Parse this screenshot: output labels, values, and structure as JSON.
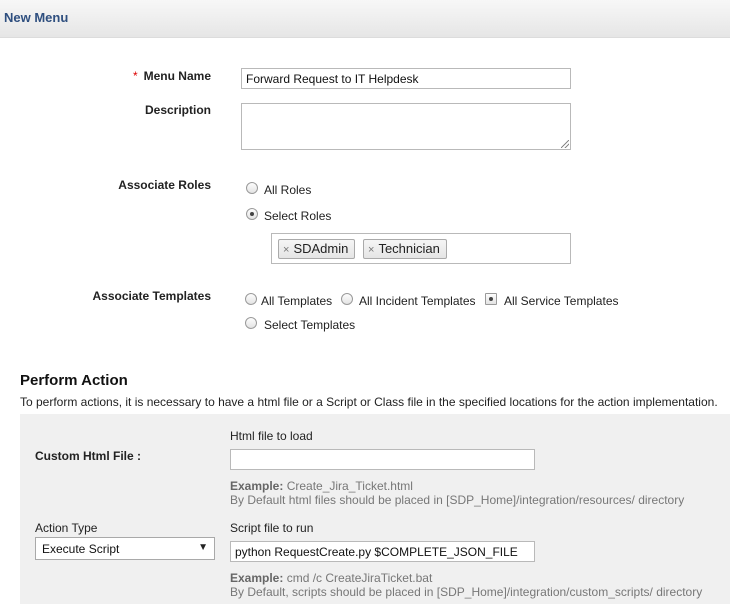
{
  "header": {
    "title": "New Menu"
  },
  "form": {
    "menu_name": {
      "required_mark": "*",
      "label": "Menu Name",
      "value": "Forward Request to IT Helpdesk"
    },
    "description": {
      "label": "Description",
      "value": ""
    },
    "roles": {
      "label": "Associate Roles",
      "options": [
        {
          "label": "All Roles",
          "checked": false
        },
        {
          "label": "Select Roles",
          "checked": true
        }
      ],
      "selected": [
        "SDAdmin",
        "Technician"
      ],
      "remove_glyph": "×"
    },
    "templates": {
      "label": "Associate Templates",
      "options": [
        {
          "label": "All Templates",
          "checked": false
        },
        {
          "label": "All Incident Templates",
          "checked": false
        },
        {
          "label": "All Service Templates",
          "checked": true
        },
        {
          "label": "Select Templates",
          "checked": false
        }
      ]
    }
  },
  "perform_action": {
    "title": "Perform Action",
    "description": "To perform actions, it is necessary to have a html file or a Script or Class file in the specified locations for the action implementation.",
    "custom_html": {
      "label": "Custom Html File :",
      "field_label": "Html file to load",
      "value": "",
      "example_prefix": "Example:",
      "example_value": "Create_Jira_Ticket.html",
      "note": "By Default html files should be placed in [SDP_Home]/integration/resources/ directory"
    },
    "action_type": {
      "label": "Action Type",
      "selected": "Execute Script",
      "arrow": "▼"
    },
    "script": {
      "field_label": "Script file to run",
      "value": "python RequestCreate.py $COMPLETE_JSON_FILE",
      "example_prefix": "Example:",
      "example_value": "cmd /c CreateJiraTicket.bat",
      "note": "By Default, scripts should be placed in [SDP_Home]/integration/custom_scripts/ directory"
    }
  }
}
